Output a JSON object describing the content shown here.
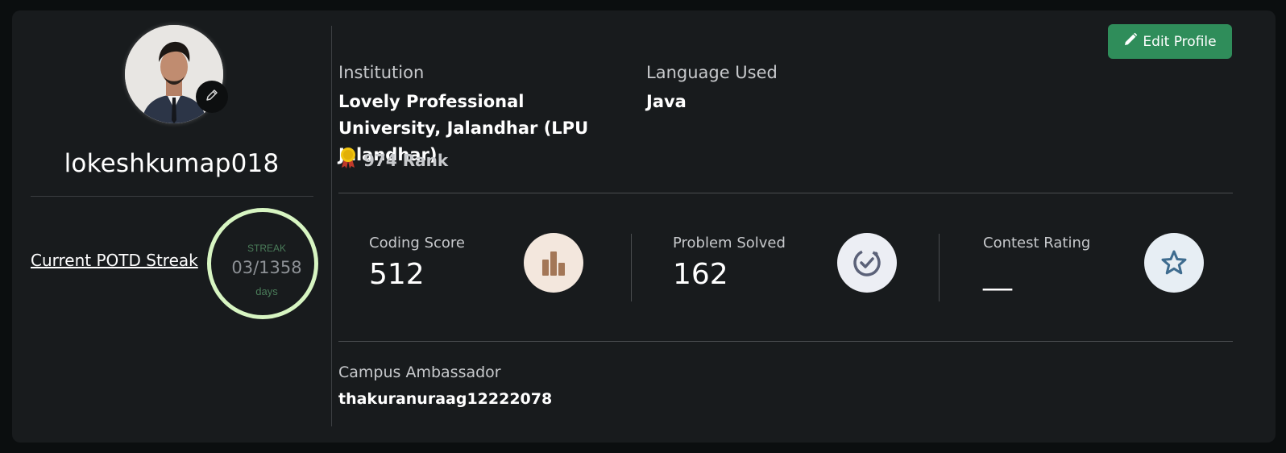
{
  "profile": {
    "username": "lokeshkumap018",
    "streak_link": "Current POTD Streak",
    "streak_label": "STREAK",
    "streak_value": "03/1358",
    "streak_days": "days"
  },
  "header": {
    "edit_profile_label": "Edit Profile"
  },
  "info": {
    "institution_label": "Institution",
    "institution_value": "Lovely Professional University, Jalandhar (LPU Jalandhar)",
    "language_label": "Language Used",
    "language_value": "Java",
    "rank": "974 Rank"
  },
  "stats": [
    {
      "label": "Coding Score",
      "value": "512",
      "icon": "bar-chart-icon"
    },
    {
      "label": "Problem Solved",
      "value": "162",
      "icon": "check-circle-icon"
    },
    {
      "label": "Contest Rating",
      "value": "__",
      "icon": "star-icon"
    }
  ],
  "campus": {
    "label": "Campus Ambassador",
    "value": "thakuranuraag12222078"
  },
  "colors": {
    "accent": "#2f8d5a",
    "streak_ring": "#d7f5c2",
    "card": "#181b1d",
    "background": "#0b0e0f"
  }
}
